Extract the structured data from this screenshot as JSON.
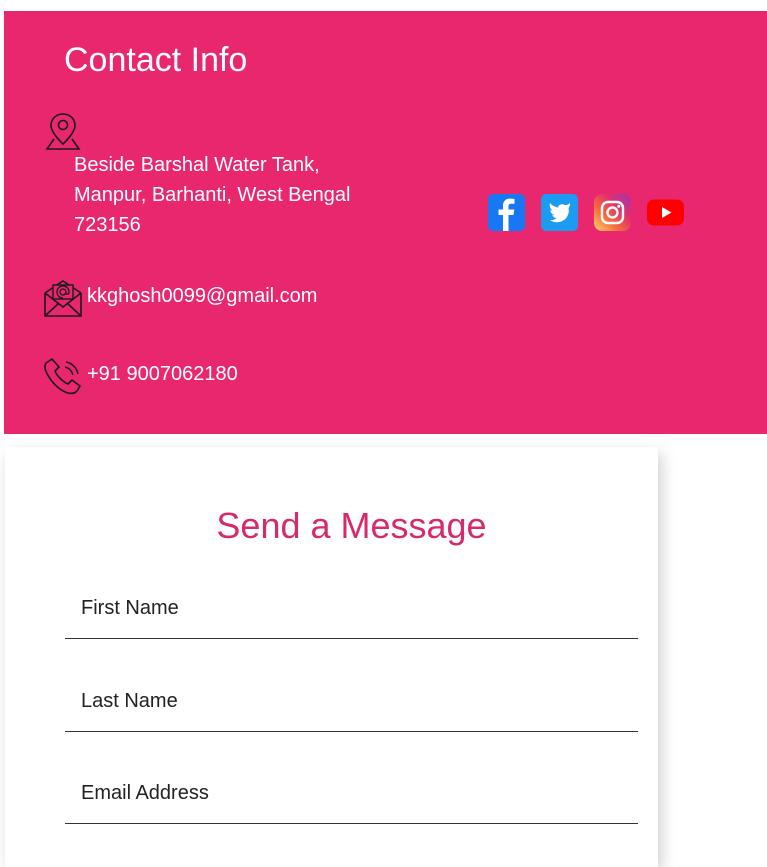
{
  "contact": {
    "title": "Contact Info",
    "address_lines": [
      "Beside Barshal Water Tank,",
      "Manpur, Barhanti, West Bengal",
      "723156"
    ],
    "email": "kkghosh0099@gmail.com",
    "phone": "+91 9007062180",
    "icons": {
      "address": "location-pin-icon",
      "email": "envelope-at-icon",
      "phone": "phone-icon"
    },
    "socials": [
      {
        "name": "facebook",
        "icon": "facebook-icon",
        "color": "#1877f2"
      },
      {
        "name": "twitter",
        "icon": "twitter-icon",
        "color": "#1da1f2"
      },
      {
        "name": "instagram",
        "icon": "instagram-icon",
        "color": "#e1306c"
      },
      {
        "name": "youtube",
        "icon": "youtube-icon",
        "color": "#ff0000"
      }
    ],
    "bg_color": "#e8276f"
  },
  "form": {
    "title": "Send a Message",
    "title_color": "#d62a6c",
    "fields": [
      {
        "placeholder": "First Name",
        "value": ""
      },
      {
        "placeholder": "Last Name",
        "value": ""
      },
      {
        "placeholder": "Email Address",
        "value": ""
      }
    ]
  }
}
